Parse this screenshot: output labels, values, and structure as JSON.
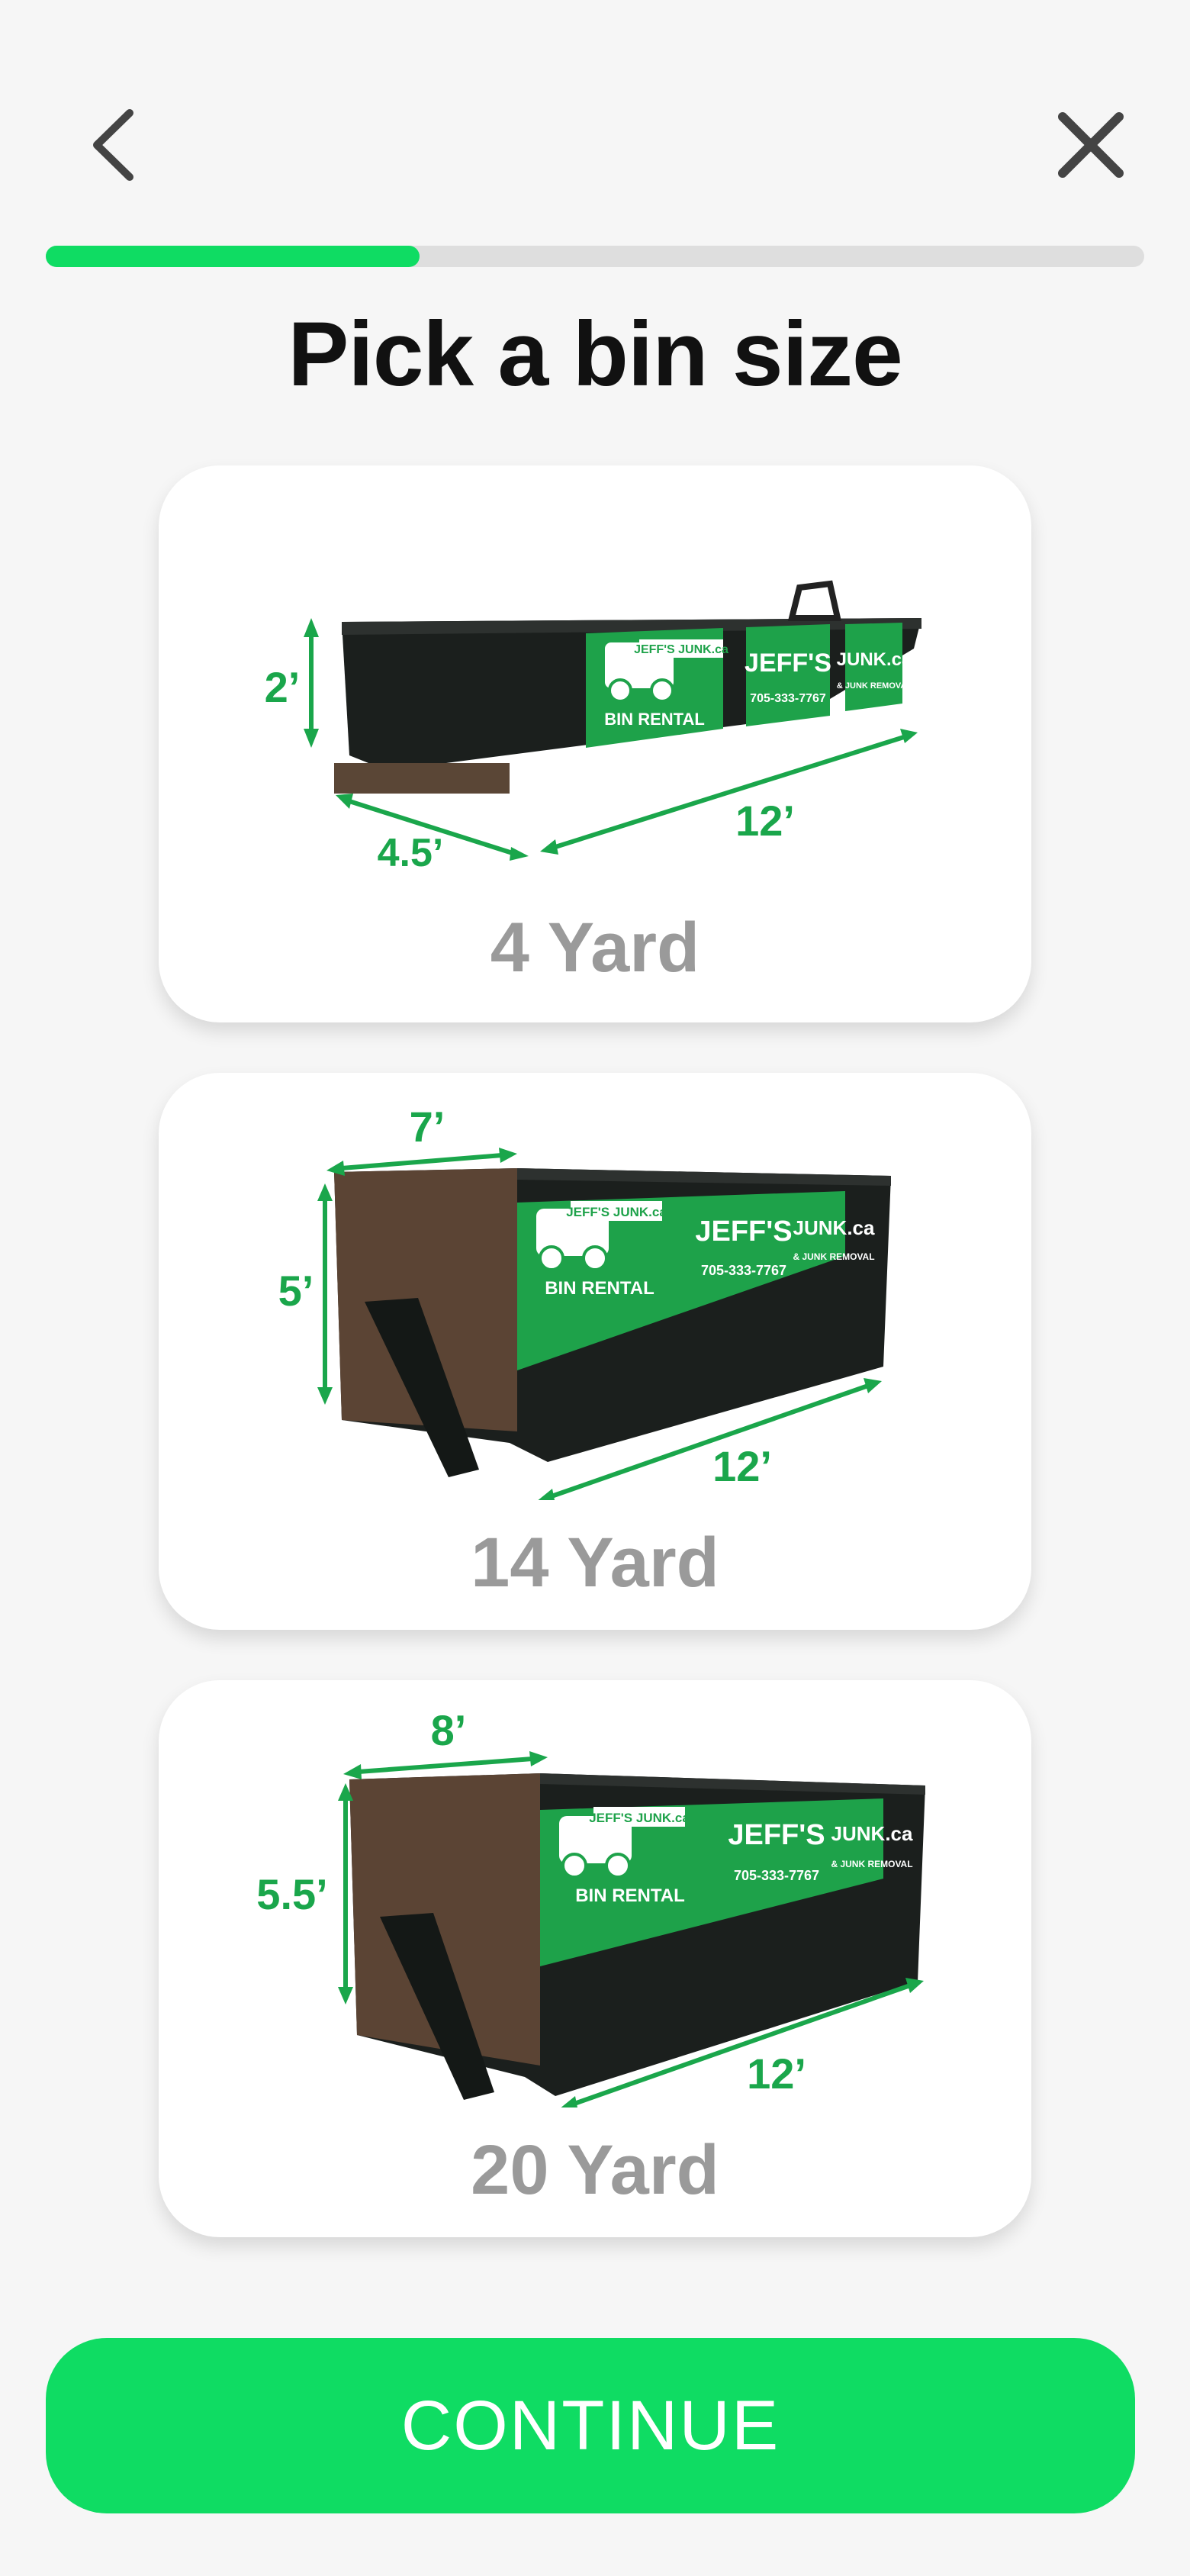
{
  "header": {
    "back_icon": "chevron-left-icon",
    "close_icon": "close-icon"
  },
  "progress": {
    "fraction": 0.34
  },
  "page_title": "Pick a bin size",
  "bins": [
    {
      "label": "4 Yard",
      "dims": {
        "height": "2’",
        "width": "4.5’",
        "length": "12’"
      },
      "logo": "JEFF'S JUNK.ca",
      "tag": "BIN RENTAL",
      "brand": "JEFF'S",
      "phone": "705-333-7767",
      "subbrand": "JUNK.ca",
      "service": "& JUNK REMOVAL"
    },
    {
      "label": "14 Yard",
      "dims": {
        "width": "7’",
        "height": "5’",
        "length": "12’"
      },
      "logo": "JEFF'S JUNK.ca",
      "tag": "BIN RENTAL",
      "brand": "JEFF'S",
      "phone": "705-333-7767",
      "subbrand": "JUNK.ca",
      "service": "& JUNK REMOVAL"
    },
    {
      "label": "20 Yard",
      "dims": {
        "width": "8’",
        "height": "5.5’",
        "length": "12’"
      },
      "logo": "JEFF'S JUNK.ca",
      "tag": "BIN RENTAL",
      "brand": "JEFF'S",
      "phone": "705-333-7767",
      "subbrand": "JUNK.ca",
      "service": "& JUNK REMOVAL"
    }
  ],
  "continue_label": "CONTINUE",
  "colors": {
    "accent": "#0fdc63",
    "dimension": "#1aa64b",
    "bin_body": "#1b1f1d"
  }
}
